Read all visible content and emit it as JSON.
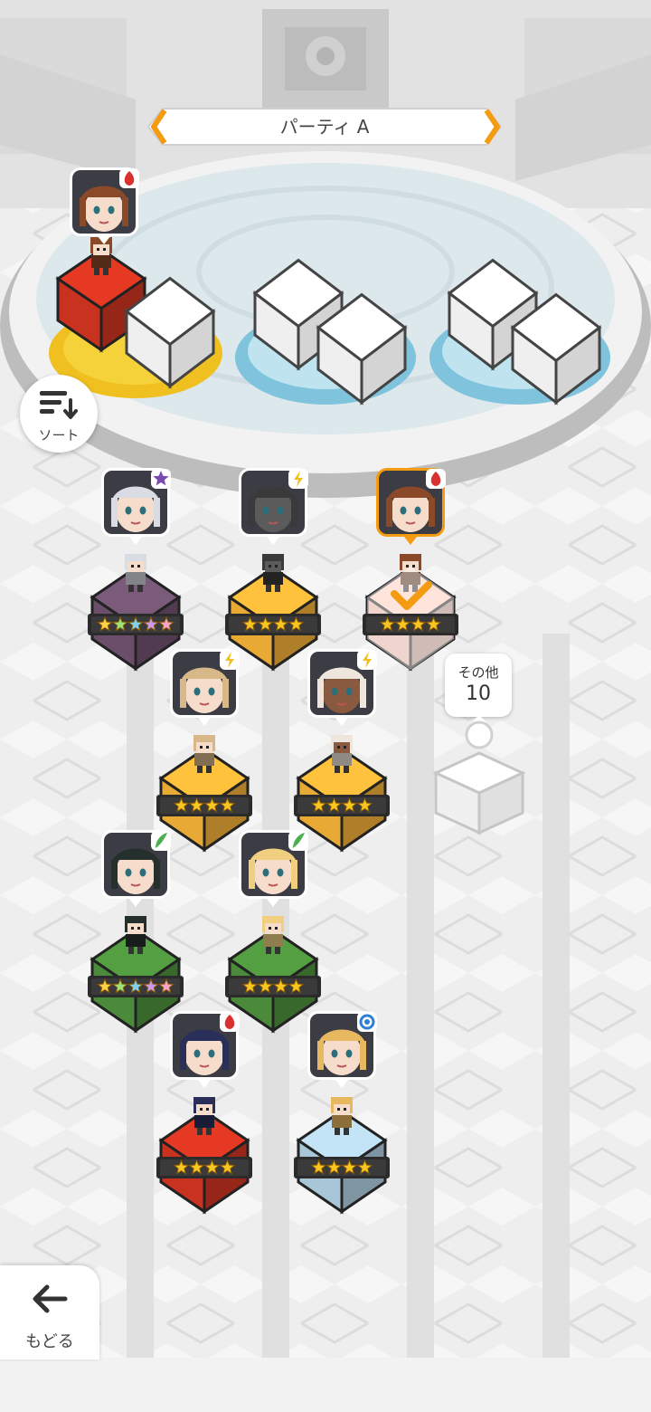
{
  "party": {
    "title": "パーティ A"
  },
  "sort_button": {
    "label": "ソート",
    "icon": "sort-icon"
  },
  "back_button": {
    "label": "もどる",
    "icon": "arrow-left-icon"
  },
  "others": {
    "label": "その他",
    "count": "10"
  },
  "formation": {
    "slots": [
      {
        "occupied": true,
        "base_color": "#c8321e",
        "element": "heart"
      },
      {
        "occupied": false
      },
      {
        "occupied": false
      }
    ]
  },
  "characters": [
    {
      "name": "silver-haired-girl",
      "stars": 5,
      "rainbow": true,
      "base_color": "#6b4f6a",
      "element": "dark",
      "element_color": "#7a4ab0",
      "hair": "#d9dde3",
      "skin": "#f6dccb",
      "selected": false
    },
    {
      "name": "green-visor-robot",
      "stars": 4,
      "rainbow": false,
      "base_color": "#e8a935",
      "element": "thunder",
      "element_color": "#f0c020",
      "hair": "#3a3a3a",
      "skin": "#5b5b5b",
      "selected": false
    },
    {
      "name": "brown-haired-boy",
      "stars": 4,
      "rainbow": false,
      "base_color": "#e9b1a3",
      "element": "fire",
      "element_color": "#d93030",
      "hair": "#8a4a2a",
      "skin": "#f6dccb",
      "selected": true
    },
    {
      "name": "blonde-woman",
      "stars": 4,
      "rainbow": false,
      "base_color": "#e8a935",
      "element": "thunder",
      "element_color": "#f0c020",
      "hair": "#d8b888",
      "skin": "#f6dccb",
      "selected": false
    },
    {
      "name": "white-haired-warrior",
      "stars": 4,
      "rainbow": false,
      "base_color": "#e8a935",
      "element": "thunder",
      "element_color": "#f0c020",
      "hair": "#eee6dc",
      "skin": "#8a5a40",
      "selected": false
    },
    {
      "name": "dark-haired-maid",
      "stars": 5,
      "rainbow": true,
      "base_color": "#4a8a3a",
      "element": "wind",
      "element_color": "#4caf50",
      "hair": "#25302c",
      "skin": "#f6dccb",
      "selected": false
    },
    {
      "name": "blonde-elf",
      "stars": 4,
      "rainbow": false,
      "base_color": "#4a8a3a",
      "element": "wind",
      "element_color": "#4caf50",
      "hair": "#f0d080",
      "skin": "#f6dccb",
      "selected": false
    },
    {
      "name": "navy-haired-fighter",
      "stars": 4,
      "rainbow": false,
      "base_color": "#c8321e",
      "element": "fire",
      "element_color": "#d93030",
      "hair": "#2a2f5a",
      "skin": "#f6dccb",
      "selected": false
    },
    {
      "name": "blonde-knight",
      "stars": 4,
      "rainbow": false,
      "base_color": "#a9c6d6",
      "element": "water",
      "element_color": "#2f7fd6",
      "hair": "#e8b860",
      "skin": "#f6dccb",
      "selected": false
    }
  ],
  "colors": {
    "accent": "#f39c12",
    "cube_top": "#ffffff",
    "cube_side": "#cfcfcf",
    "pad_blue": "#9fd6ea"
  }
}
